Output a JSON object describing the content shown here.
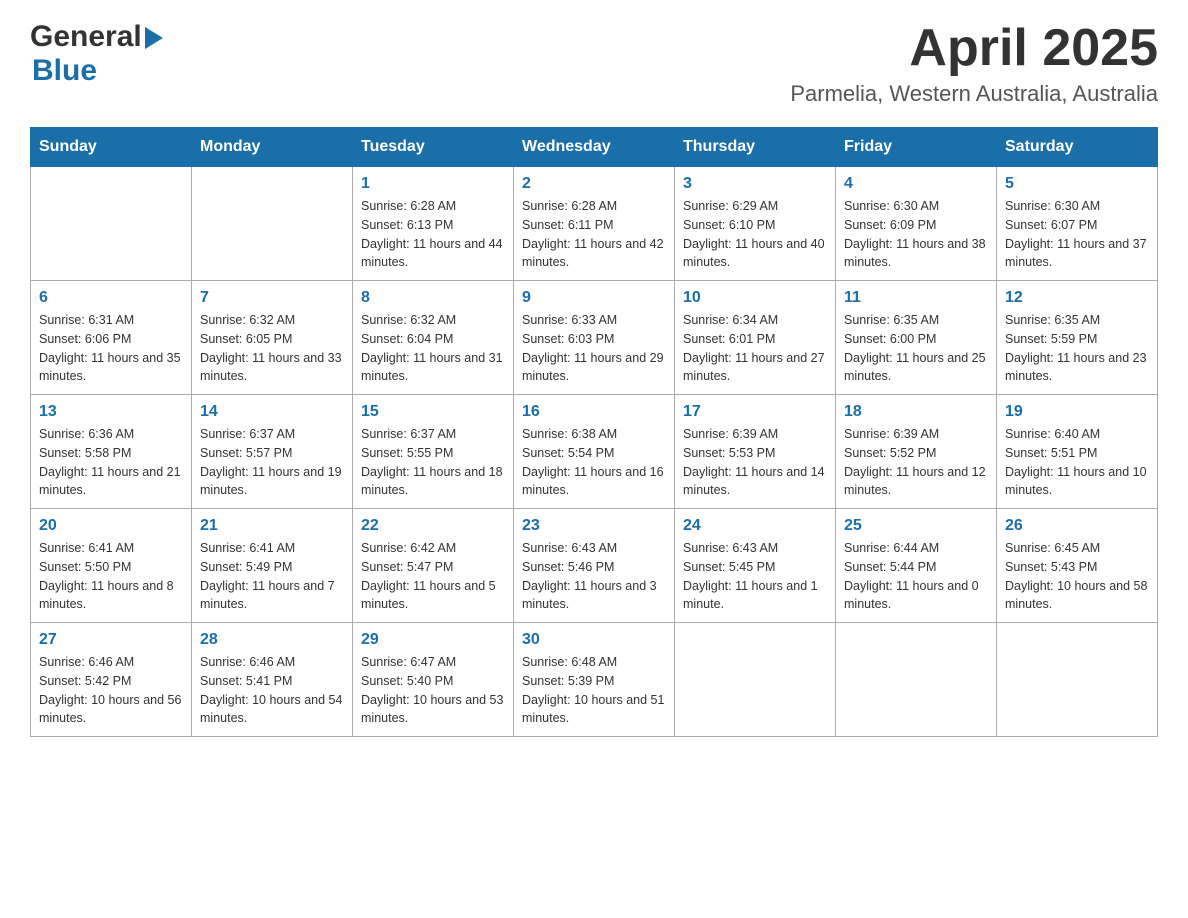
{
  "header": {
    "logo_general": "General",
    "logo_blue": "Blue",
    "month_title": "April 2025",
    "location": "Parmelia, Western Australia, Australia"
  },
  "weekdays": [
    "Sunday",
    "Monday",
    "Tuesday",
    "Wednesday",
    "Thursday",
    "Friday",
    "Saturday"
  ],
  "weeks": [
    [
      {
        "day": "",
        "sunrise": "",
        "sunset": "",
        "daylight": ""
      },
      {
        "day": "",
        "sunrise": "",
        "sunset": "",
        "daylight": ""
      },
      {
        "day": "1",
        "sunrise": "Sunrise: 6:28 AM",
        "sunset": "Sunset: 6:13 PM",
        "daylight": "Daylight: 11 hours and 44 minutes."
      },
      {
        "day": "2",
        "sunrise": "Sunrise: 6:28 AM",
        "sunset": "Sunset: 6:11 PM",
        "daylight": "Daylight: 11 hours and 42 minutes."
      },
      {
        "day": "3",
        "sunrise": "Sunrise: 6:29 AM",
        "sunset": "Sunset: 6:10 PM",
        "daylight": "Daylight: 11 hours and 40 minutes."
      },
      {
        "day": "4",
        "sunrise": "Sunrise: 6:30 AM",
        "sunset": "Sunset: 6:09 PM",
        "daylight": "Daylight: 11 hours and 38 minutes."
      },
      {
        "day": "5",
        "sunrise": "Sunrise: 6:30 AM",
        "sunset": "Sunset: 6:07 PM",
        "daylight": "Daylight: 11 hours and 37 minutes."
      }
    ],
    [
      {
        "day": "6",
        "sunrise": "Sunrise: 6:31 AM",
        "sunset": "Sunset: 6:06 PM",
        "daylight": "Daylight: 11 hours and 35 minutes."
      },
      {
        "day": "7",
        "sunrise": "Sunrise: 6:32 AM",
        "sunset": "Sunset: 6:05 PM",
        "daylight": "Daylight: 11 hours and 33 minutes."
      },
      {
        "day": "8",
        "sunrise": "Sunrise: 6:32 AM",
        "sunset": "Sunset: 6:04 PM",
        "daylight": "Daylight: 11 hours and 31 minutes."
      },
      {
        "day": "9",
        "sunrise": "Sunrise: 6:33 AM",
        "sunset": "Sunset: 6:03 PM",
        "daylight": "Daylight: 11 hours and 29 minutes."
      },
      {
        "day": "10",
        "sunrise": "Sunrise: 6:34 AM",
        "sunset": "Sunset: 6:01 PM",
        "daylight": "Daylight: 11 hours and 27 minutes."
      },
      {
        "day": "11",
        "sunrise": "Sunrise: 6:35 AM",
        "sunset": "Sunset: 6:00 PM",
        "daylight": "Daylight: 11 hours and 25 minutes."
      },
      {
        "day": "12",
        "sunrise": "Sunrise: 6:35 AM",
        "sunset": "Sunset: 5:59 PM",
        "daylight": "Daylight: 11 hours and 23 minutes."
      }
    ],
    [
      {
        "day": "13",
        "sunrise": "Sunrise: 6:36 AM",
        "sunset": "Sunset: 5:58 PM",
        "daylight": "Daylight: 11 hours and 21 minutes."
      },
      {
        "day": "14",
        "sunrise": "Sunrise: 6:37 AM",
        "sunset": "Sunset: 5:57 PM",
        "daylight": "Daylight: 11 hours and 19 minutes."
      },
      {
        "day": "15",
        "sunrise": "Sunrise: 6:37 AM",
        "sunset": "Sunset: 5:55 PM",
        "daylight": "Daylight: 11 hours and 18 minutes."
      },
      {
        "day": "16",
        "sunrise": "Sunrise: 6:38 AM",
        "sunset": "Sunset: 5:54 PM",
        "daylight": "Daylight: 11 hours and 16 minutes."
      },
      {
        "day": "17",
        "sunrise": "Sunrise: 6:39 AM",
        "sunset": "Sunset: 5:53 PM",
        "daylight": "Daylight: 11 hours and 14 minutes."
      },
      {
        "day": "18",
        "sunrise": "Sunrise: 6:39 AM",
        "sunset": "Sunset: 5:52 PM",
        "daylight": "Daylight: 11 hours and 12 minutes."
      },
      {
        "day": "19",
        "sunrise": "Sunrise: 6:40 AM",
        "sunset": "Sunset: 5:51 PM",
        "daylight": "Daylight: 11 hours and 10 minutes."
      }
    ],
    [
      {
        "day": "20",
        "sunrise": "Sunrise: 6:41 AM",
        "sunset": "Sunset: 5:50 PM",
        "daylight": "Daylight: 11 hours and 8 minutes."
      },
      {
        "day": "21",
        "sunrise": "Sunrise: 6:41 AM",
        "sunset": "Sunset: 5:49 PM",
        "daylight": "Daylight: 11 hours and 7 minutes."
      },
      {
        "day": "22",
        "sunrise": "Sunrise: 6:42 AM",
        "sunset": "Sunset: 5:47 PM",
        "daylight": "Daylight: 11 hours and 5 minutes."
      },
      {
        "day": "23",
        "sunrise": "Sunrise: 6:43 AM",
        "sunset": "Sunset: 5:46 PM",
        "daylight": "Daylight: 11 hours and 3 minutes."
      },
      {
        "day": "24",
        "sunrise": "Sunrise: 6:43 AM",
        "sunset": "Sunset: 5:45 PM",
        "daylight": "Daylight: 11 hours and 1 minute."
      },
      {
        "day": "25",
        "sunrise": "Sunrise: 6:44 AM",
        "sunset": "Sunset: 5:44 PM",
        "daylight": "Daylight: 11 hours and 0 minutes."
      },
      {
        "day": "26",
        "sunrise": "Sunrise: 6:45 AM",
        "sunset": "Sunset: 5:43 PM",
        "daylight": "Daylight: 10 hours and 58 minutes."
      }
    ],
    [
      {
        "day": "27",
        "sunrise": "Sunrise: 6:46 AM",
        "sunset": "Sunset: 5:42 PM",
        "daylight": "Daylight: 10 hours and 56 minutes."
      },
      {
        "day": "28",
        "sunrise": "Sunrise: 6:46 AM",
        "sunset": "Sunset: 5:41 PM",
        "daylight": "Daylight: 10 hours and 54 minutes."
      },
      {
        "day": "29",
        "sunrise": "Sunrise: 6:47 AM",
        "sunset": "Sunset: 5:40 PM",
        "daylight": "Daylight: 10 hours and 53 minutes."
      },
      {
        "day": "30",
        "sunrise": "Sunrise: 6:48 AM",
        "sunset": "Sunset: 5:39 PM",
        "daylight": "Daylight: 10 hours and 51 minutes."
      },
      {
        "day": "",
        "sunrise": "",
        "sunset": "",
        "daylight": ""
      },
      {
        "day": "",
        "sunrise": "",
        "sunset": "",
        "daylight": ""
      },
      {
        "day": "",
        "sunrise": "",
        "sunset": "",
        "daylight": ""
      }
    ]
  ]
}
